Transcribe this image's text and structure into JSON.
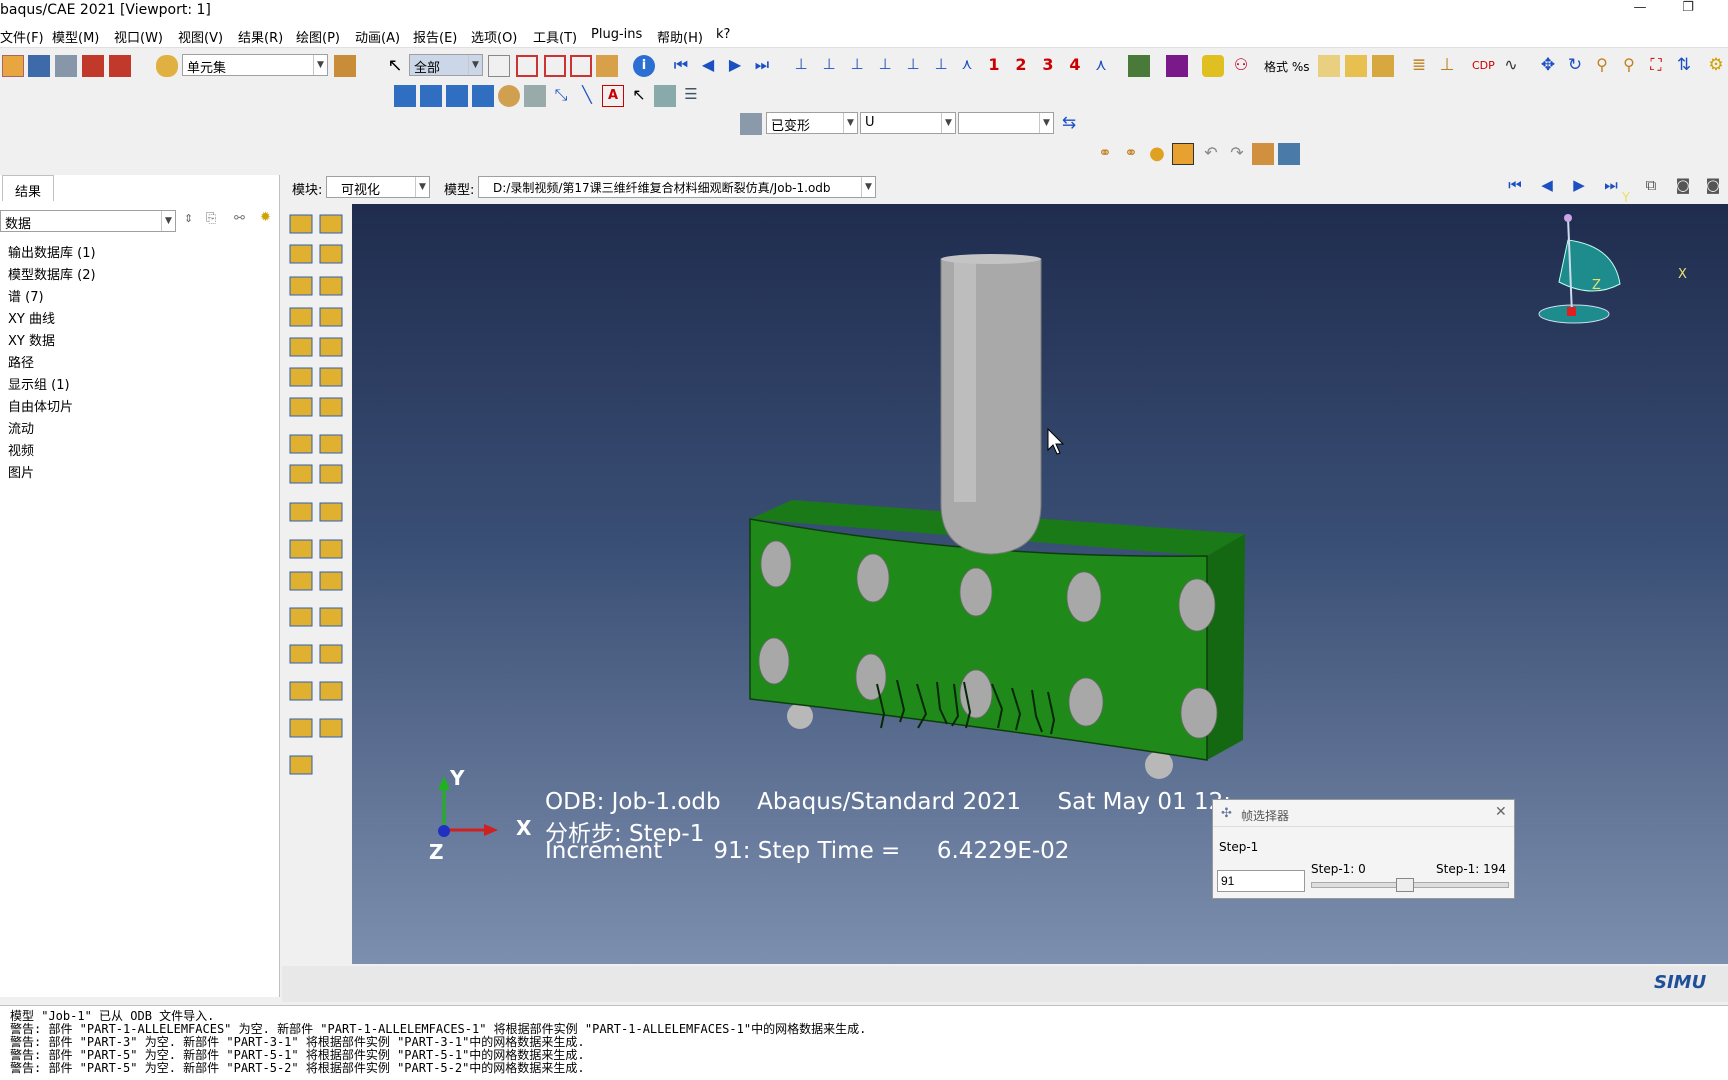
{
  "window": {
    "title": "baqus/CAE 2021 [Viewport: 1]",
    "minimize": "—",
    "restore": "❐"
  },
  "menu": [
    "文件(F)",
    "模型(M)",
    "视口(W)",
    "视图(V)",
    "结果(R)",
    "绘图(P)",
    "动画(A)",
    "报告(E)",
    "选项(O)",
    "工具(T)",
    "Plug-ins",
    "帮助(H)",
    "k?"
  ],
  "toolbar": {
    "set_type": "单元集",
    "selection": "全部",
    "info_icon": "i",
    "numbers": [
      "1",
      "2",
      "3",
      "4"
    ],
    "format_label": "格式 %s"
  },
  "field_toolbar": {
    "deform": "已变形",
    "variable": "U",
    "component": ""
  },
  "module_bar": {
    "module_label": "模块:",
    "module_value": "可视化",
    "model_label": "模型:",
    "model_value": "D:/录制视频/第17课三维纤维复合材料细观断裂仿真/Job-1.odb"
  },
  "panel": {
    "tab": "结果",
    "filter": "数据",
    "items": [
      "输出数据库 (1)",
      "模型数据库 (2)",
      "谱 (7)",
      "XY 曲线",
      "XY 数据",
      "路径",
      "显示组 (1)",
      "自由体切片",
      "流动",
      "视频",
      "图片"
    ]
  },
  "viewport": {
    "triad": {
      "y": "Y",
      "z": "Z",
      "x": "X"
    },
    "info_line1": "ODB: Job-1.odb     Abaqus/Standard 2021     Sat May 01 12:",
    "info_line2": "分析步: Step-1",
    "info_line3": "Increment       91: Step Time =     6.4229E-02",
    "brand": "SIMU",
    "view_triad": {
      "y": "Y",
      "x": "X",
      "z": "Z"
    }
  },
  "frame_selector": {
    "title": "帧选择器",
    "step": "Step-1",
    "frame_value": "91",
    "min_label": "Step-1: 0",
    "max_label": "Step-1: 194",
    "slider_fraction": 0.47
  },
  "messages": [
    "模型 \"Job-1\" 已从 ODB 文件导入.",
    "警告: 部件 \"PART-1-ALLELEMFACES\" 为空. 新部件 \"PART-1-ALLELEMFACES-1\" 将根据部件实例 \"PART-1-ALLELEMFACES-1\"中的网格数据来生成.",
    "警告: 部件 \"PART-3\" 为空. 新部件 \"PART-3-1\" 将根据部件实例 \"PART-3-1\"中的网格数据来生成.",
    "警告: 部件 \"PART-5\" 为空. 新部件 \"PART-5-1\" 将根据部件实例 \"PART-5-1\"中的网格数据来生成.",
    "警告: 部件 \"PART-5\" 为空. 新部件 \"PART-5-2\" 将根据部件实例 \"PART-5-2\"中的网格数据来生成."
  ],
  "colors": {
    "specimen": "#1f8a1a",
    "indenter": "#a9a9a9",
    "viewport_top": "#1f2c4e",
    "viewport_bottom": "#7d8fae"
  }
}
